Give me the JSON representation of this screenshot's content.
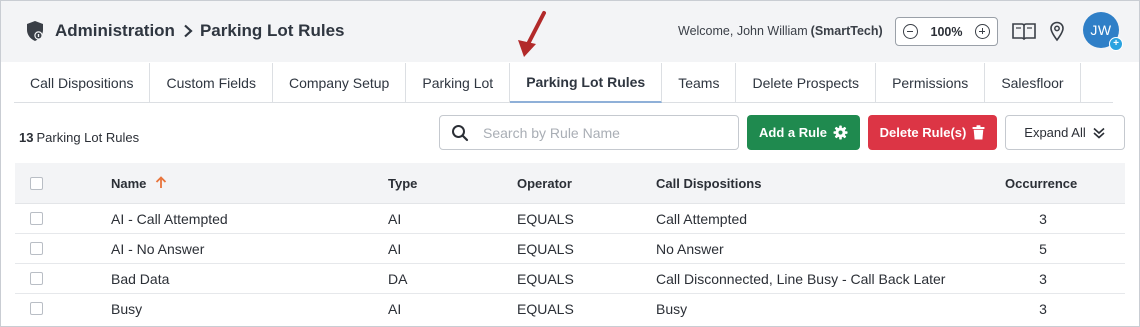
{
  "header": {
    "breadcrumb_root": "Administration",
    "breadcrumb_current": "Parking Lot Rules",
    "welcome_prefix": "Welcome, John William",
    "welcome_org": "(SmartTech)",
    "zoom_level": "100%",
    "avatar_initials": "JW",
    "avatar_badge": "+"
  },
  "tabs": [
    {
      "label": "Call Dispositions"
    },
    {
      "label": "Custom Fields"
    },
    {
      "label": "Company Setup"
    },
    {
      "label": "Parking Lot"
    },
    {
      "label": "Parking Lot Rules",
      "active": true
    },
    {
      "label": "Teams"
    },
    {
      "label": "Delete Prospects"
    },
    {
      "label": "Permissions"
    },
    {
      "label": "Salesfloor"
    }
  ],
  "toolbar": {
    "count": "13",
    "count_label": "Parking Lot Rules",
    "search_placeholder": "Search by Rule Name",
    "search_value": "",
    "add_label": "Add a Rule",
    "delete_label": "Delete Rule(s)",
    "expand_label": "Expand All"
  },
  "table": {
    "columns": {
      "name": "Name",
      "type": "Type",
      "operator": "Operator",
      "dispositions": "Call Dispositions",
      "occurrence": "Occurrence"
    },
    "rows": [
      {
        "name": "AI - Call Attempted",
        "type": "AI",
        "operator": "EQUALS",
        "dispositions": "Call Attempted",
        "occurrence": "3"
      },
      {
        "name": "AI - No Answer",
        "type": "AI",
        "operator": "EQUALS",
        "dispositions": "No Answer",
        "occurrence": "5"
      },
      {
        "name": "Bad Data",
        "type": "DA",
        "operator": "EQUALS",
        "dispositions": "Call Disconnected, Line Busy - Call Back Later",
        "occurrence": "3"
      },
      {
        "name": "Busy",
        "type": "AI",
        "operator": "EQUALS",
        "dispositions": "Busy",
        "occurrence": "3"
      }
    ]
  },
  "colors": {
    "accent_green": "#1f8a4f",
    "accent_red": "#dc3545",
    "avatar_blue": "#2f7fc7",
    "sort_arrow": "#e8743b",
    "annotation_arrow": "#b22a2a"
  },
  "icons": {
    "breadcrumb": "shield-building-icon",
    "book": "book-open-icon",
    "location": "map-pin-icon",
    "add": "gear-icon",
    "delete": "trash-icon",
    "expand": "chevron-double-down-icon",
    "search": "search-icon",
    "sort": "sort-arrow-up-icon"
  }
}
